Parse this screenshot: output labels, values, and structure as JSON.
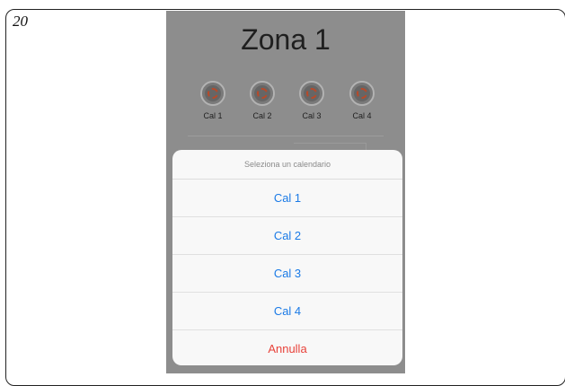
{
  "page_number": "20",
  "zone": {
    "title": "Zona 1"
  },
  "calendars": [
    {
      "label": "Cal 1"
    },
    {
      "label": "Cal 2"
    },
    {
      "label": "Cal 3"
    },
    {
      "label": "Cal 4"
    }
  ],
  "action_sheet": {
    "title": "Seleziona un calendario",
    "options": [
      "Cal 1",
      "Cal 2",
      "Cal 3",
      "Cal 4"
    ],
    "cancel_label": "Annulla"
  },
  "colors": {
    "accent": "#1a7ae6",
    "cancel": "#e8423a",
    "overlay": "#8d8d8d"
  }
}
